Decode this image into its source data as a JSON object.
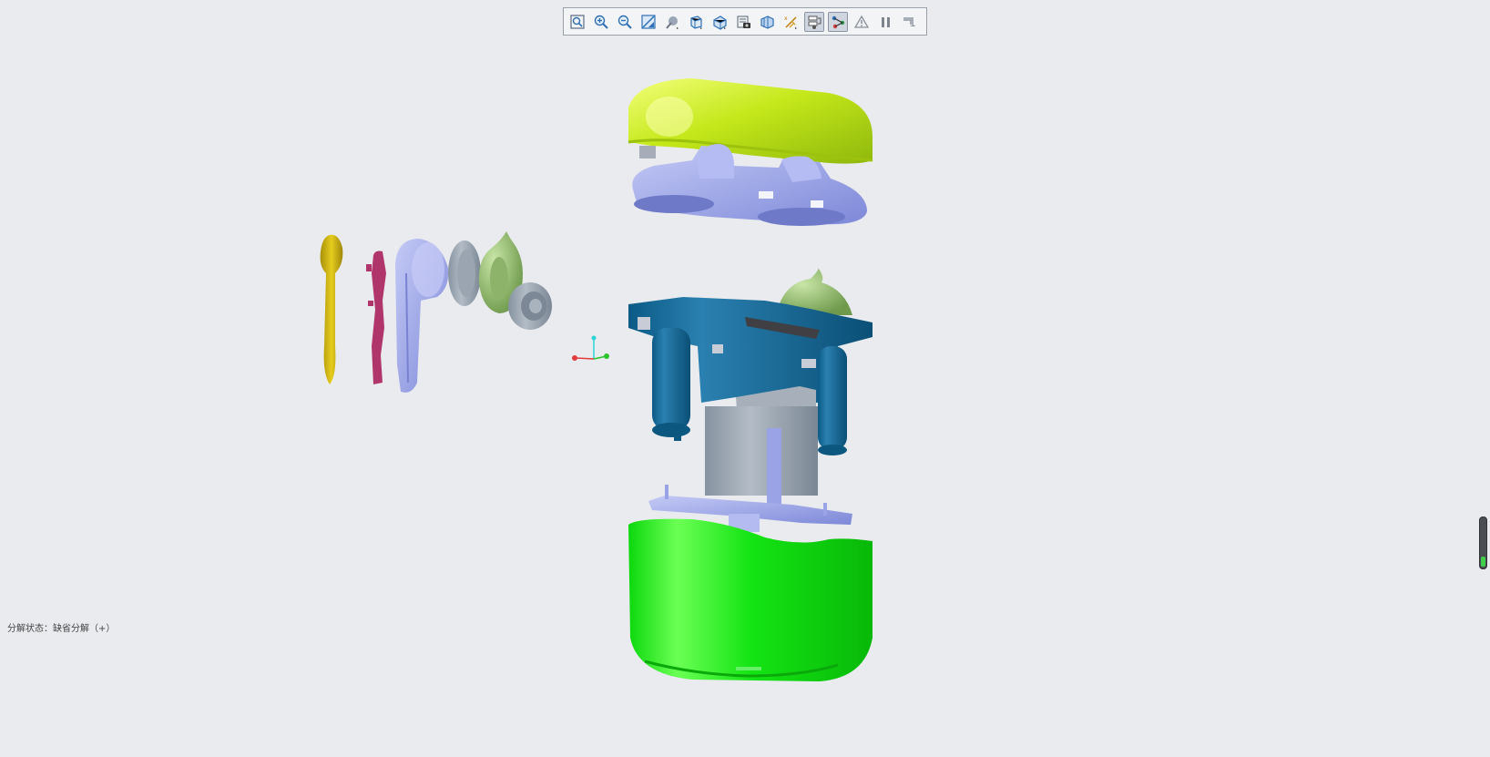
{
  "toolbar": {
    "buttons": [
      {
        "name": "zoom-fit-button",
        "icon": "zoom-fit-icon",
        "active": false
      },
      {
        "name": "zoom-in-button",
        "icon": "zoom-in-icon",
        "active": false
      },
      {
        "name": "zoom-out-button",
        "icon": "zoom-out-icon",
        "active": false
      },
      {
        "name": "repaint-button",
        "icon": "repaint-icon",
        "active": false
      },
      {
        "name": "display-style-button",
        "icon": "display-style-icon",
        "active": false
      },
      {
        "name": "saved-orientation-button",
        "icon": "view-cube-icon",
        "active": false
      },
      {
        "name": "view-manager-button",
        "icon": "view-manager-icon",
        "active": false
      },
      {
        "name": "camera-button",
        "icon": "camera-icon",
        "active": false
      },
      {
        "name": "section-view-button",
        "icon": "section-icon",
        "active": false
      },
      {
        "name": "datum-display-button",
        "icon": "datum-icon",
        "active": false
      },
      {
        "name": "annotation-display-button",
        "icon": "annotation-icon",
        "active": true
      },
      {
        "name": "explode-lines-button",
        "icon": "explode-lines-icon",
        "active": true
      },
      {
        "name": "spin-center-button",
        "icon": "triangle-warning-icon",
        "active": false
      },
      {
        "name": "pause-button",
        "icon": "pause-icon",
        "active": false
      },
      {
        "name": "regenerate-button",
        "icon": "regenerate-icon",
        "active": false
      }
    ]
  },
  "status": {
    "text": "分解状态：缺省分解（+）"
  },
  "colors": {
    "background": "#e9ebee",
    "lid_yellow": "#c8ec1a",
    "lavender": "#9aa3e6",
    "blue": "#11648f",
    "green": "#12dc12",
    "gray": "#8f9aa6",
    "gold": "#c9b10a",
    "magenta": "#b0356b"
  },
  "scroll_indicator": {
    "level": 0.2
  }
}
